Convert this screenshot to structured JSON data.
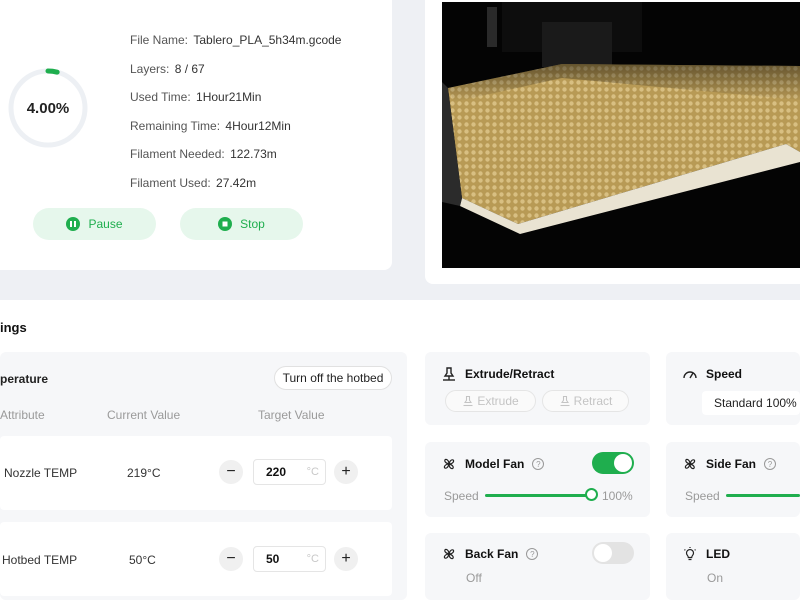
{
  "print_status": {
    "progress_text": "4.00%",
    "progress_fraction": 0.04,
    "file_name_label": "File Name:",
    "file_name": "Tablero_PLA_5h34m.gcode",
    "layers_label": "Layers:",
    "layers": "8 / 67",
    "used_time_label": "Used Time:",
    "used_time": "1Hour21Min",
    "remaining_time_label": "Remaining Time:",
    "remaining_time": "4Hour12Min",
    "filament_needed_label": "Filament Needed:",
    "filament_needed": "122.73m",
    "filament_used_label": "Filament Used:",
    "filament_used": "27.42m",
    "pause_label": "Pause",
    "stop_label": "Stop"
  },
  "settings": {
    "section_title": "ings",
    "temperature": {
      "title": "perature",
      "hotbed_off_label": "Turn off the hotbed",
      "col_attribute": "Attribute",
      "col_current": "Current Value",
      "col_target": "Target Value",
      "rows": [
        {
          "label": "Nozzle TEMP",
          "current": "219°C",
          "target": "220",
          "unit": "°C"
        },
        {
          "label": "Hotbed TEMP",
          "current": "50°C",
          "target": "50",
          "unit": "°C"
        }
      ]
    },
    "extrude": {
      "title": "Extrude/Retract",
      "extrude_label": "Extrude",
      "retract_label": "Retract"
    },
    "speed": {
      "title": "Speed",
      "value": "Standard 100%"
    },
    "model_fan": {
      "title": "Model Fan",
      "enabled": true,
      "speed_label": "Speed",
      "speed_value": "100%",
      "speed_fraction": 1.0
    },
    "side_fan": {
      "title": "Side Fan",
      "speed_label": "Speed"
    },
    "back_fan": {
      "title": "Back Fan",
      "enabled": false,
      "state": "Off"
    },
    "led": {
      "title": "LED",
      "state": "On"
    }
  },
  "colors": {
    "accent": "#1fae4e",
    "accent_light": "#e6f7ec",
    "background": "#eef0f4"
  }
}
